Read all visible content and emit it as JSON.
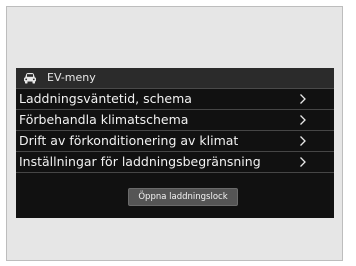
{
  "header": {
    "icon": "car-icon",
    "title": "EV-meny"
  },
  "menu": {
    "items": [
      {
        "label": "Laddningsväntetid, schema",
        "icon": "chevron-right-icon"
      },
      {
        "label": "Förbehandla klimatschema",
        "icon": "chevron-right-icon"
      },
      {
        "label": "Drift av förkonditionering av klimat",
        "icon": "chevron-right-icon"
      },
      {
        "label": "Inställningar för laddningsbegränsning",
        "icon": "chevron-right-icon"
      }
    ]
  },
  "actions": {
    "open_hatch_label": "Öppna laddningslock"
  },
  "colors": {
    "screen_background": "#111111",
    "header_background": "#2b2b2b",
    "text": "#f2f2f2",
    "button_background": "#555555",
    "frame_background": "#e6e6e6"
  }
}
